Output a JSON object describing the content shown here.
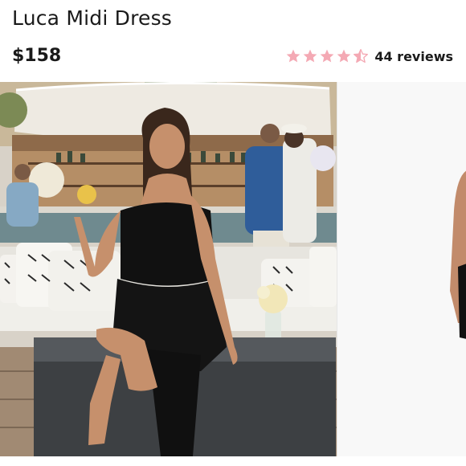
{
  "product": {
    "title": "Luca Midi Dress",
    "price": "$158",
    "rating": {
      "value": 4.5,
      "max": 5,
      "reviews_label": "44 reviews"
    }
  },
  "colors": {
    "star": "#f4a9b4",
    "text": "#1a1a1a"
  },
  "gallery": {
    "images": [
      {
        "name": "woman-in-black-midi-dress-at-outdoor-bar"
      },
      {
        "name": "model-in-dress-on-white-background"
      }
    ]
  }
}
